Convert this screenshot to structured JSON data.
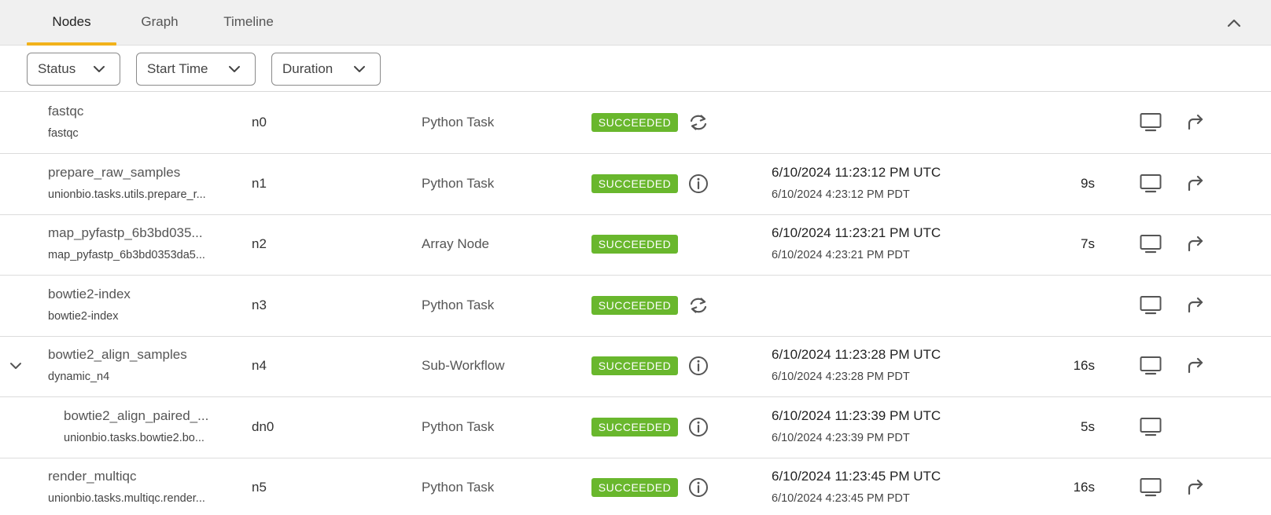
{
  "tabs": [
    {
      "label": "Nodes"
    },
    {
      "label": "Graph"
    },
    {
      "label": "Timeline"
    }
  ],
  "active_tab": "Nodes",
  "filters": [
    {
      "label": "Status"
    },
    {
      "label": "Start Time"
    },
    {
      "label": "Duration"
    }
  ],
  "status_color": "#69b72d",
  "accent_color": "#f2b21b",
  "rows": [
    {
      "name": "fastqc",
      "subtitle": "fastqc",
      "node_id": "n0",
      "type": "Python Task",
      "status": "SUCCEEDED",
      "status_icon": "cached-icon",
      "start_utc": "",
      "start_local": "",
      "duration": "",
      "rerun": true
    },
    {
      "name": "prepare_raw_samples",
      "subtitle": "unionbio.tasks.utils.prepare_r...",
      "node_id": "n1",
      "type": "Python Task",
      "status": "SUCCEEDED",
      "status_icon": "info-icon",
      "start_utc": "6/10/2024 11:23:12 PM UTC",
      "start_local": "6/10/2024 4:23:12 PM PDT",
      "duration": "9s",
      "rerun": true
    },
    {
      "name": "map_pyfastp_6b3bd035...",
      "subtitle": "map_pyfastp_6b3bd0353da5...",
      "node_id": "n2",
      "type": "Array Node",
      "status": "SUCCEEDED",
      "status_icon": "",
      "start_utc": "6/10/2024 11:23:21 PM UTC",
      "start_local": "6/10/2024 4:23:21 PM PDT",
      "duration": "7s",
      "rerun": true
    },
    {
      "name": "bowtie2-index",
      "subtitle": "bowtie2-index",
      "node_id": "n3",
      "type": "Python Task",
      "status": "SUCCEEDED",
      "status_icon": "cached-icon",
      "start_utc": "",
      "start_local": "",
      "duration": "",
      "rerun": true
    },
    {
      "name": "bowtie2_align_samples",
      "subtitle": "dynamic_n4",
      "node_id": "n4",
      "type": "Sub-Workflow",
      "status": "SUCCEEDED",
      "status_icon": "info-icon",
      "start_utc": "6/10/2024 11:23:28 PM UTC",
      "start_local": "6/10/2024 4:23:28 PM PDT",
      "duration": "16s",
      "rerun": true,
      "expandable": true
    },
    {
      "name": "bowtie2_align_paired_...",
      "subtitle": "unionbio.tasks.bowtie2.bo...",
      "node_id": "dn0",
      "type": "Python Task",
      "status": "SUCCEEDED",
      "status_icon": "info-icon",
      "start_utc": "6/10/2024 11:23:39 PM UTC",
      "start_local": "6/10/2024 4:23:39 PM PDT",
      "duration": "5s",
      "rerun": false,
      "indent": true
    },
    {
      "name": "render_multiqc",
      "subtitle": "unionbio.tasks.multiqc.render...",
      "node_id": "n5",
      "type": "Python Task",
      "status": "SUCCEEDED",
      "status_icon": "info-icon",
      "start_utc": "6/10/2024 11:23:45 PM UTC",
      "start_local": "6/10/2024 4:23:45 PM PDT",
      "duration": "16s",
      "rerun": true
    }
  ]
}
